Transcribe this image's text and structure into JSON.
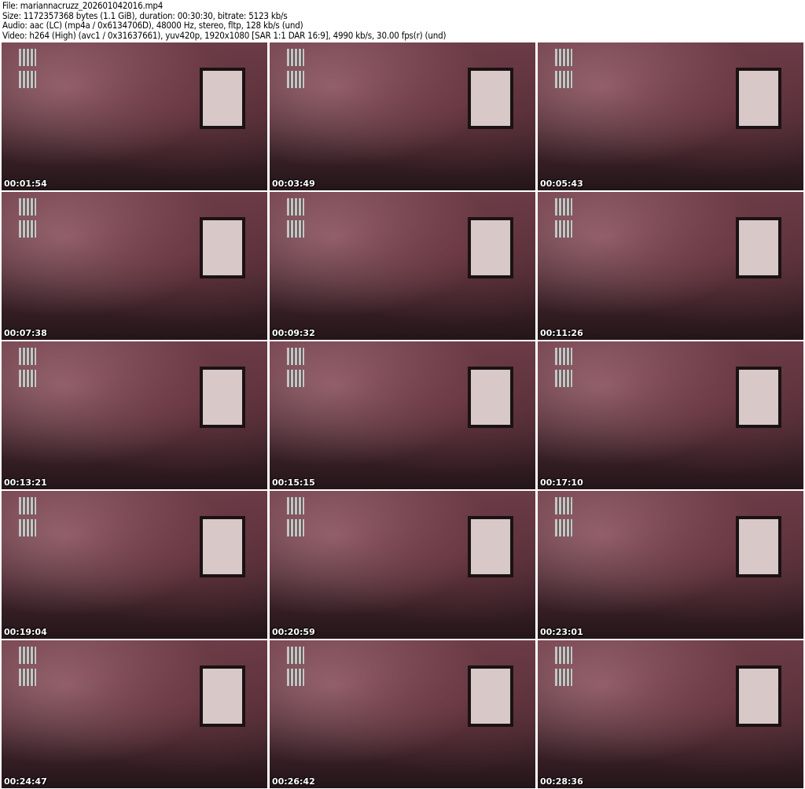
{
  "header": {
    "file": "File: mariannacruzz_202601042016.mp4",
    "size": "Size: 1172357368 bytes (1.1 GiB), duration: 00:30:30, bitrate: 5123 kb/s",
    "audio": "Audio: aac (LC) (mp4a / 0x6134706D), 48000 Hz, stereo, fltp, 128 kb/s (und)",
    "video": "Video: h264 (High) (avc1 / 0x31637661), yuv420p, 1920x1080 [SAR 1:1 DAR 16:9], 4990 kb/s, 30.00 fps(r) (und)"
  },
  "thumbnails": [
    "00:01:54",
    "00:03:49",
    "00:05:43",
    "00:07:38",
    "00:09:32",
    "00:11:26",
    "00:13:21",
    "00:15:15",
    "00:17:10",
    "00:19:04",
    "00:20:59",
    "00:23:01",
    "00:24:47",
    "00:26:42",
    "00:28:36"
  ]
}
